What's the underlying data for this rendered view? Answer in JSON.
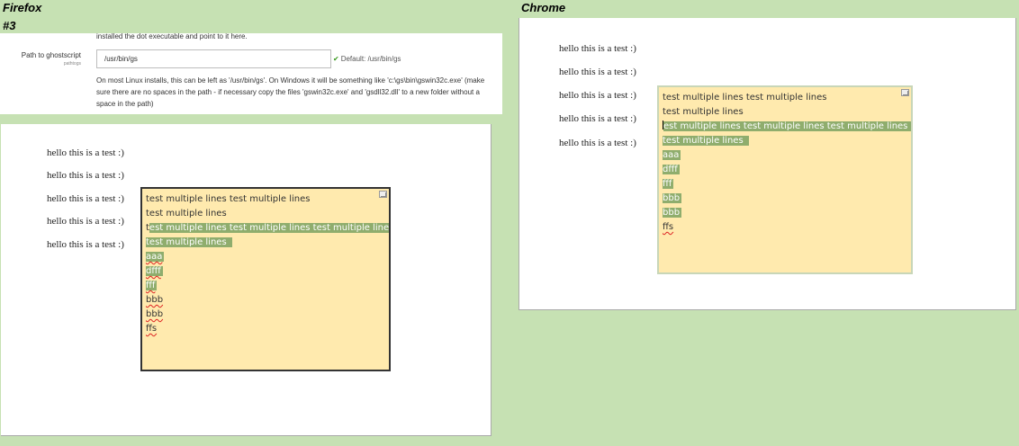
{
  "labels": {
    "firefox": "Firefox",
    "chrome": "Chrome",
    "issue_number": "#3"
  },
  "settings": {
    "top_help_text": "installed the dot executable and point to it here.",
    "field_label": "Path to ghostscript",
    "field_sublabel": "pathtogs",
    "path_value": "/usr/bin/gs",
    "default_note": "Default: /usr/bin/gs",
    "help_line1": "On most Linux installs, this can be left as '/usr/bin/gs'. On Windows it will be something like 'c:\\gs\\bin\\gswin32c.exe' (make",
    "help_line2": "sure there are no spaces in the path - if necessary copy the files 'gswin32c.exe' and 'gsdll32.dll' to a new folder without a",
    "help_line3": "space in the path)"
  },
  "hello_lines": [
    "hello this is a test :)",
    "hello this is a test :)",
    "hello this is a test :)",
    "hello this is a test :)",
    "hello this is a test :)"
  ],
  "note": {
    "line1": "test multiple lines test multiple lines",
    "line2": "test multiple lines",
    "line3_caret_char": "t",
    "line3_selected": "est multiple lines test multiple lines test multiple lines",
    "line4": "test multiple lines",
    "line5": "aaa",
    "line6": "dfff",
    "line7": "fff",
    "line8": "bbb",
    "line9": "bbb",
    "line10": "ffs"
  }
}
